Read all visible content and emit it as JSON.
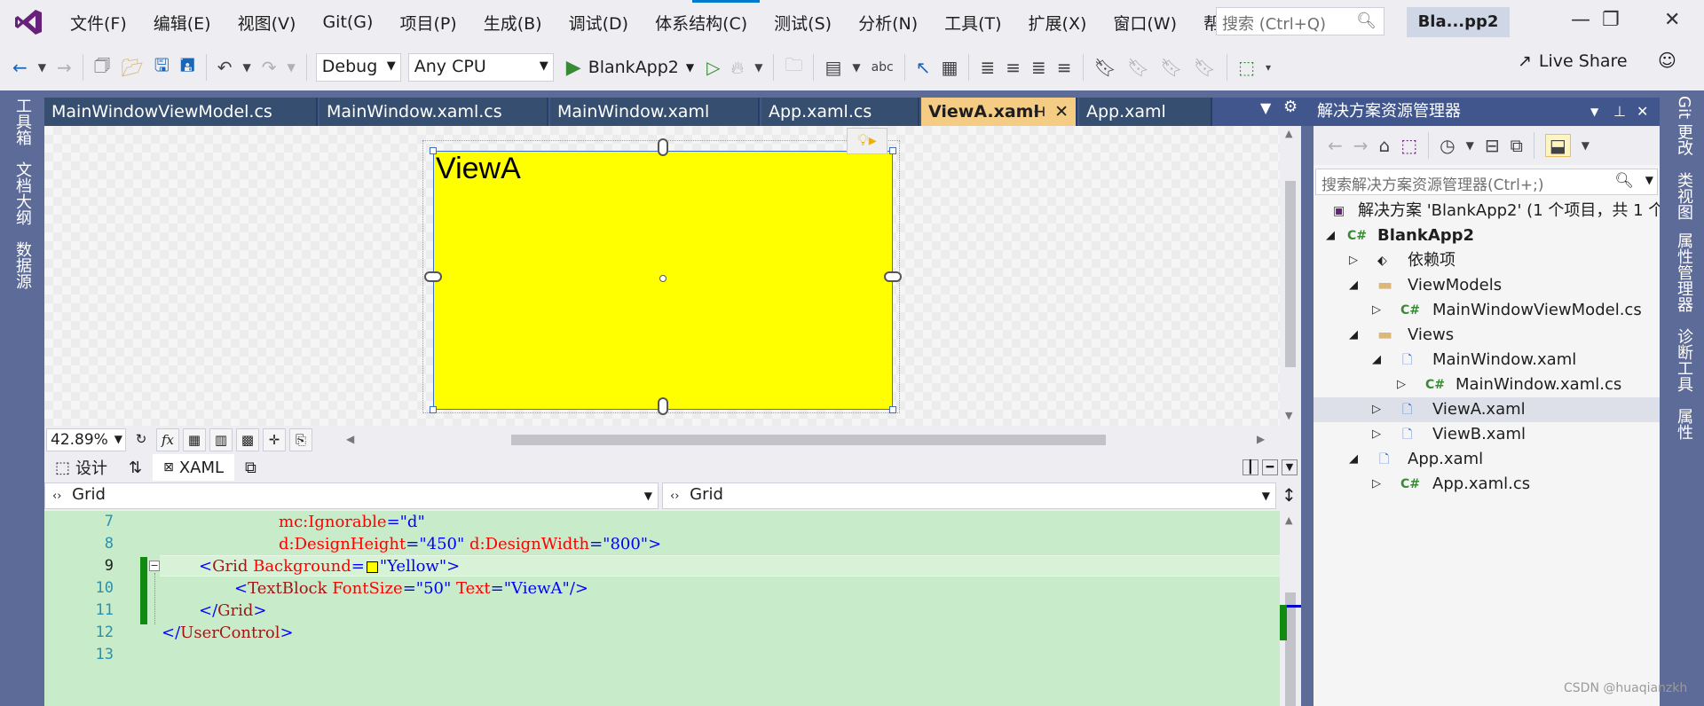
{
  "menu": [
    "文件(F)",
    "编辑(E)",
    "视图(V)",
    "Git(G)",
    "项目(P)",
    "生成(B)",
    "调试(D)",
    "体系结构(C)",
    "测试(S)",
    "分析(N)",
    "工具(T)",
    "扩展(X)",
    "窗口(W)",
    "帮助(H)"
  ],
  "search": {
    "placeholder": "搜索 (Ctrl+Q)"
  },
  "project_badge": "Bla...pp2",
  "toolbar": {
    "config": "Debug",
    "platform": "Any CPU",
    "run_target": "BlankApp2",
    "live_share": "Live Share"
  },
  "left_strip": [
    "工具箱",
    "文档大纲",
    "数据源"
  ],
  "right_strip": [
    "Git 更改",
    "类视图",
    "属性管理器",
    "诊断工具",
    "属性"
  ],
  "tabs": [
    {
      "label": "MainWindowViewModel.cs"
    },
    {
      "label": "MainWindow.xaml.cs"
    },
    {
      "label": "MainWindow.xaml"
    },
    {
      "label": "App.xaml.cs"
    },
    {
      "label": "ViewA.xaml",
      "active": true
    },
    {
      "label": "App.xaml"
    }
  ],
  "designer": {
    "text": "ViewA",
    "background": "#ffff00"
  },
  "zoom": "42.89%",
  "split": {
    "design_label": "设计",
    "xaml_label": "XAML"
  },
  "nav": {
    "left": "Grid",
    "right": "Grid"
  },
  "code": {
    "line_numbers": [
      "7",
      "8",
      "9",
      "10",
      "11",
      "12",
      "13"
    ],
    "l6": {
      "prefix": "mc",
      "attr": ":Ignorable",
      "eq": "=",
      "val": "\"d\""
    },
    "l7": {
      "a1": "d:DesignHeight",
      "v1": "\"450\"",
      "a2": "d:DesignWidth",
      "v2": "\"800\"",
      "end": ">"
    },
    "l8": {
      "open": "<",
      "tag": "Grid",
      "attr": "Background",
      "eq": "=",
      "val": "\"Yellow\"",
      "end": ">"
    },
    "l9": {
      "open": "<",
      "tag": "TextBlock",
      "a1": "FontSize",
      "v1": "\"50\"",
      "a2": "Text",
      "v2": "\"ViewA\"",
      "end": "/>"
    },
    "l10": {
      "open": "</",
      "tag": "Grid",
      "end": ">"
    },
    "l11": {
      "open": "</",
      "tag": "UserControl",
      "end": ">"
    }
  },
  "solution": {
    "title": "解决方案资源管理器",
    "search_placeholder": "搜索解决方案资源管理器(Ctrl+;)",
    "tree": [
      {
        "label": "解决方案 'BlankApp2' (1 个项目，共 1 个",
        "icon": "solution-icon",
        "level": 0
      },
      {
        "label": "BlankApp2",
        "icon": "csharp-project-icon",
        "level": 1,
        "bold": true
      },
      {
        "label": "依赖项",
        "icon": "dependencies-icon",
        "level": 2
      },
      {
        "label": "ViewModels",
        "icon": "folder-icon",
        "level": 2
      },
      {
        "label": "MainWindowViewModel.cs",
        "icon": "csharp-file-icon",
        "level": 3
      },
      {
        "label": "Views",
        "icon": "folder-icon",
        "level": 2
      },
      {
        "label": "MainWindow.xaml",
        "icon": "xaml-file-icon",
        "level": 3
      },
      {
        "label": "MainWindow.xaml.cs",
        "icon": "csharp-file-icon",
        "level": 4
      },
      {
        "label": "ViewA.xaml",
        "icon": "xaml-file-icon",
        "level": 3,
        "selected": true
      },
      {
        "label": "ViewB.xaml",
        "icon": "xaml-file-icon",
        "level": 3
      },
      {
        "label": "App.xaml",
        "icon": "xaml-file-icon",
        "level": 2
      },
      {
        "label": "App.xaml.cs",
        "icon": "csharp-file-icon",
        "level": 3
      }
    ]
  },
  "watermark": "CSDN @huaqianzkh"
}
